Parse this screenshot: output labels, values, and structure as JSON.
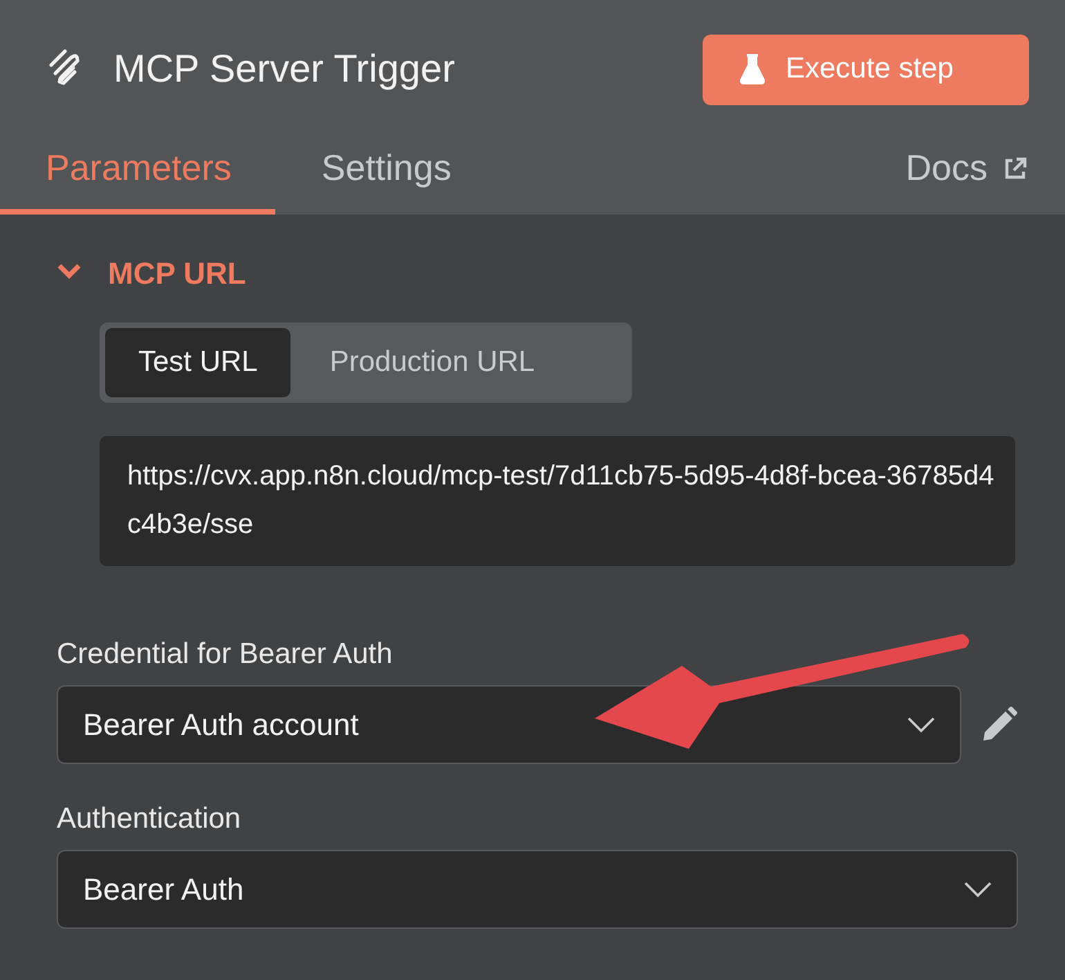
{
  "header": {
    "title": "MCP Server Trigger",
    "action_button": "Execute step"
  },
  "tabs": [
    {
      "label": "Parameters",
      "selected": true
    },
    {
      "label": "Settings",
      "selected": false
    }
  ],
  "docs_link": "Docs",
  "section": {
    "title": "MCP URL",
    "expanded": true,
    "url_modes": [
      {
        "label": "Test URL",
        "selected": true
      },
      {
        "label": "Production URL",
        "selected": false
      }
    ],
    "url": "https://cvx.app.n8n.cloud/mcp-test/7d11cb75-5d95-4d8f-bcea-36785d4c4b3e/sse"
  },
  "fields": [
    {
      "label": "Credential for Bearer Auth",
      "value": "Bearer Auth account",
      "editable": true
    },
    {
      "label": "Authentication",
      "value": "Bearer Auth",
      "editable": false
    }
  ],
  "annotation": {
    "kind": "arrow"
  }
}
